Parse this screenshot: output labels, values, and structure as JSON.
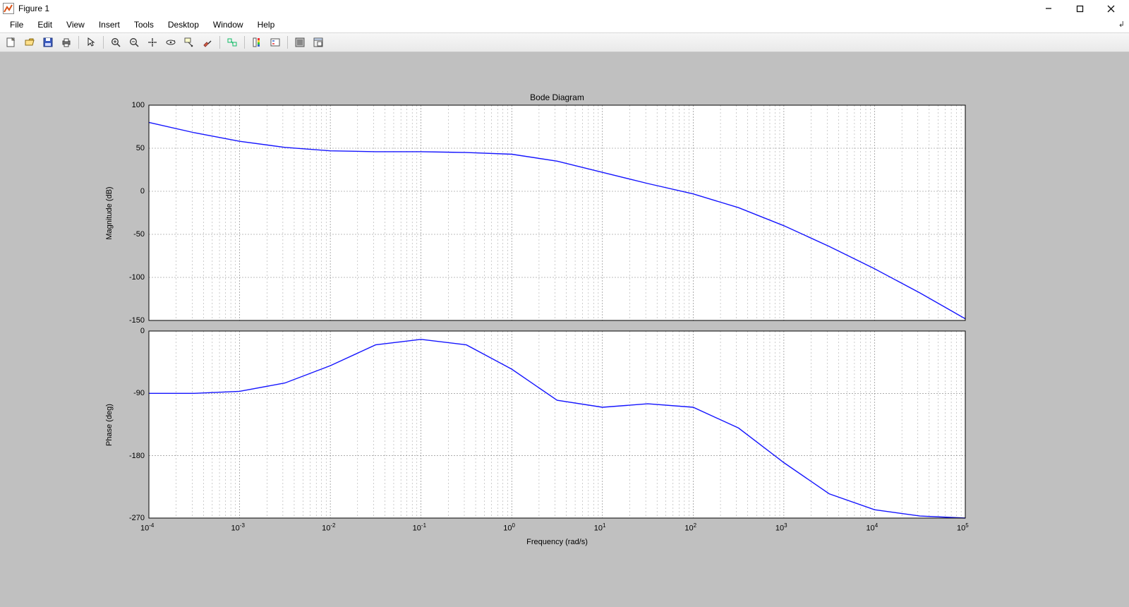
{
  "window": {
    "title": "Figure 1"
  },
  "menu": {
    "items": [
      "File",
      "Edit",
      "View",
      "Insert",
      "Tools",
      "Desktop",
      "Window",
      "Help"
    ]
  },
  "toolbar": {
    "icons": [
      "new-figure-icon",
      "open-icon",
      "save-icon",
      "print-icon",
      "sep",
      "pointer-icon",
      "sep",
      "zoom-in-icon",
      "zoom-out-icon",
      "pan-icon",
      "rotate3d-icon",
      "data-cursor-icon",
      "brush-icon",
      "sep",
      "link-plot-icon",
      "sep",
      "colorbar-icon",
      "legend-icon",
      "sep",
      "hide-tools-icon",
      "dock-icon"
    ]
  },
  "chart": {
    "title": "Bode Diagram",
    "xlabel": "Frequency  (rad/s)",
    "mag": {
      "ylabel": "Magnitude (dB)",
      "ymin": -150,
      "ymax": 100,
      "ystep": 50
    },
    "phase": {
      "ylabel": "Phase (deg)",
      "ymin": -270,
      "ymax": 0,
      "ystep": 90
    },
    "x_exp_min": -4,
    "x_exp_max": 5,
    "line_color": "#1515ff"
  },
  "chart_data": {
    "type": "line",
    "title": "Bode Diagram",
    "xlabel": "Frequency  (rad/s)",
    "x_scale": "log",
    "xlim": [
      0.0001,
      100000
    ],
    "xticks_exp": [
      -4,
      -3,
      -2,
      -1,
      0,
      1,
      2,
      3,
      4,
      5
    ],
    "series": [
      {
        "name": "Magnitude (dB)",
        "ylabel": "Magnitude (dB)",
        "ylim": [
          -150,
          100
        ],
        "yticks": [
          -150,
          -100,
          -50,
          0,
          50,
          100
        ],
        "x": [
          0.0001,
          0.000316,
          0.001,
          0.00316,
          0.01,
          0.0316,
          0.1,
          0.316,
          1,
          3.16,
          10,
          31.6,
          100,
          316,
          1000,
          3160,
          10000,
          31600,
          100000
        ],
        "y": [
          80,
          68,
          58,
          51,
          47,
          46,
          46,
          45,
          43,
          35,
          22,
          9,
          -3,
          -19,
          -40,
          -64,
          -90,
          -118,
          -148
        ]
      },
      {
        "name": "Phase (deg)",
        "ylabel": "Phase (deg)",
        "ylim": [
          -270,
          0
        ],
        "yticks": [
          -270,
          -180,
          -90,
          0
        ],
        "x": [
          0.0001,
          0.000316,
          0.001,
          0.00316,
          0.01,
          0.0316,
          0.1,
          0.316,
          1,
          3.16,
          10,
          31.6,
          100,
          316,
          1000,
          3160,
          10000,
          31600,
          100000
        ],
        "y": [
          -90,
          -90,
          -87,
          -75,
          -50,
          -20,
          -12,
          -20,
          -55,
          -100,
          -110,
          -105,
          -110,
          -140,
          -190,
          -235,
          -258,
          -267,
          -270
        ]
      }
    ]
  }
}
